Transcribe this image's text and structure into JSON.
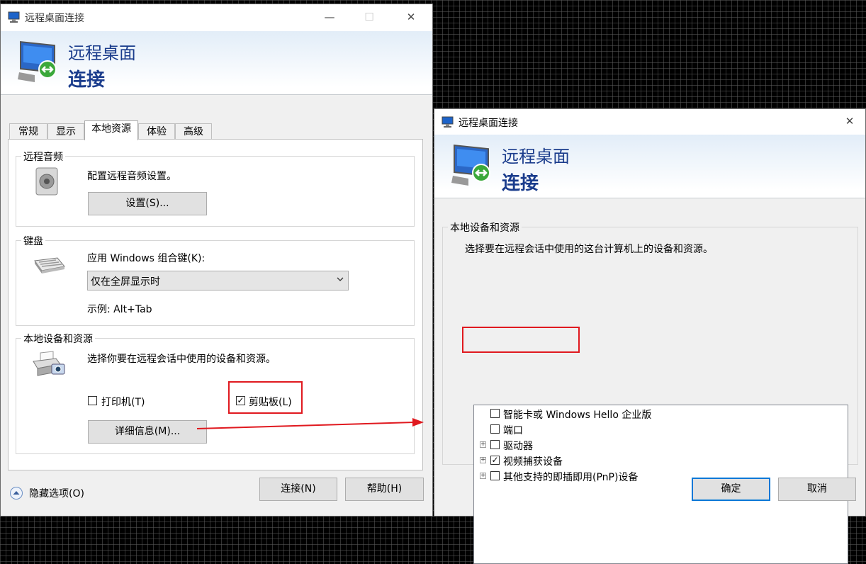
{
  "left_window": {
    "title": "远程桌面连接",
    "banner": {
      "line1": "远程桌面",
      "line2": "连接"
    },
    "tabs": [
      "常规",
      "显示",
      "本地资源",
      "体验",
      "高级"
    ],
    "audio_group": {
      "label": "远程音频",
      "description": "配置远程音频设置。",
      "settings_button": "设置(S)..."
    },
    "keyboard_group": {
      "label": "键盘",
      "prompt": "应用 Windows 组合键(K):",
      "selected_option": "仅在全屏显示时",
      "example": "示例: Alt+Tab"
    },
    "devices_group": {
      "label": "本地设备和资源",
      "description": "选择你要在远程会话中使用的设备和资源。",
      "printer_label": "打印机(T)",
      "printer_checked": false,
      "clipboard_label": "剪贴板(L)",
      "clipboard_checked": true,
      "details_button": "详细信息(M)..."
    },
    "hide_options": "隐藏选项(O)",
    "connect_button": "连接(N)",
    "help_button": "帮助(H)"
  },
  "right_window": {
    "title": "远程桌面连接",
    "banner": {
      "line1": "远程桌面",
      "line2": "连接"
    },
    "group_label": "本地设备和资源",
    "description": "选择要在远程会话中使用的这台计算机上的设备和资源。",
    "items": [
      {
        "label": "智能卡或 Windows Hello 企业版",
        "checked": false,
        "expandable": false
      },
      {
        "label": "端口",
        "checked": false,
        "expandable": false
      },
      {
        "label": "驱动器",
        "checked": false,
        "expandable": true
      },
      {
        "label": "视频捕获设备",
        "checked": true,
        "expandable": true
      },
      {
        "label": "其他支持的即插即用(PnP)设备",
        "checked": false,
        "expandable": true
      }
    ],
    "ok_button": "确定",
    "cancel_button": "取消"
  },
  "annotation_color": "#e0191f",
  "accent_color": "#0078d7"
}
